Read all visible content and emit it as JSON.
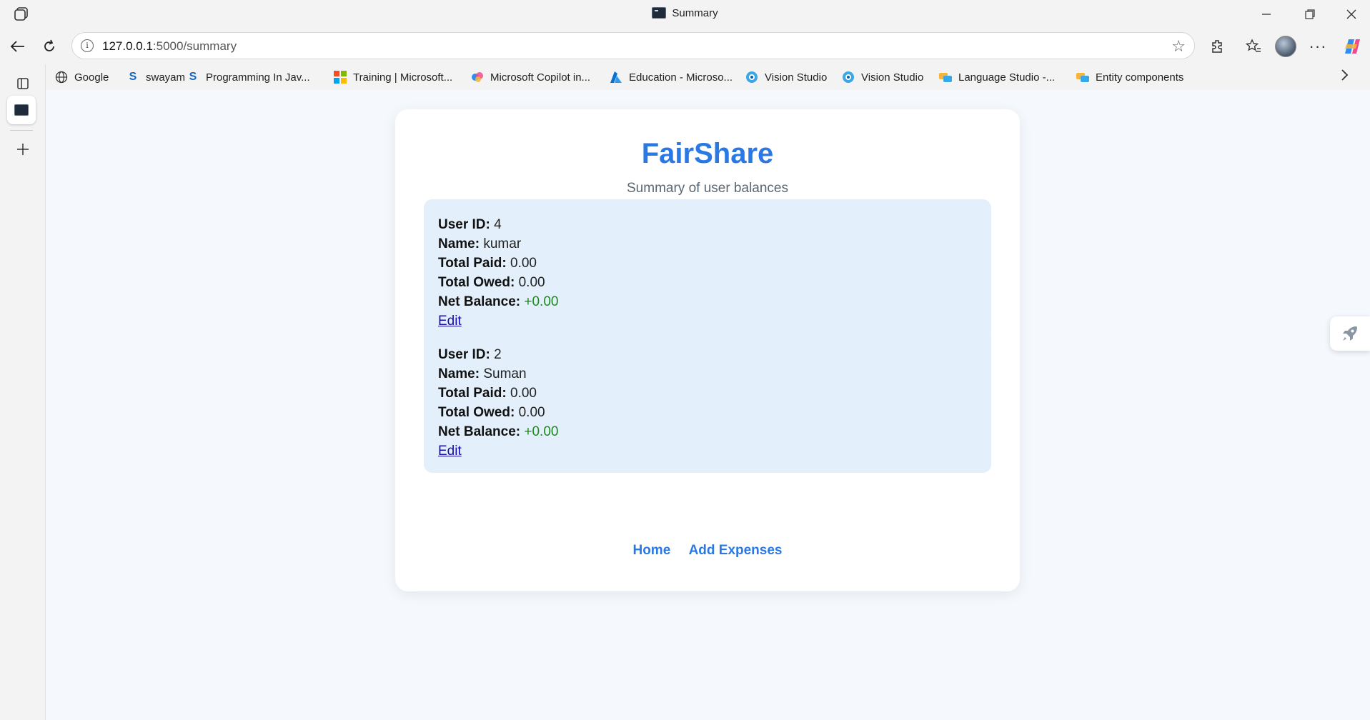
{
  "window": {
    "title": "Summary"
  },
  "address_bar": {
    "host": "127.0.0.1",
    "path": ":5000/summary"
  },
  "bookmarks": [
    {
      "label": "Google",
      "icon": "globe-icon"
    },
    {
      "label": "swayam",
      "icon": "swayam-icon"
    },
    {
      "label": "Programming In Jav...",
      "icon": "swayam-icon"
    },
    {
      "label": "Training | Microsoft...",
      "icon": "microsoft-icon"
    },
    {
      "label": "Microsoft Copilot in...",
      "icon": "copilot-icon"
    },
    {
      "label": "Education - Microso...",
      "icon": "azure-icon"
    },
    {
      "label": "Vision Studio",
      "icon": "vision-icon"
    },
    {
      "label": "Vision Studio",
      "icon": "vision-icon"
    },
    {
      "label": "Language Studio -...",
      "icon": "language-icon"
    },
    {
      "label": "Entity components",
      "icon": "language-icon"
    }
  ],
  "app": {
    "brand": "FairShare",
    "subtitle": "Summary of user balances",
    "labels": {
      "user_id": "User ID:",
      "name": "Name:",
      "total_paid": "Total Paid:",
      "total_owed": "Total Owed:",
      "net_balance": "Net Balance:",
      "edit": "Edit"
    },
    "users": [
      {
        "id": "4",
        "name": "kumar",
        "total_paid": "0.00",
        "total_owed": "0.00",
        "net_balance": "+0.00"
      },
      {
        "id": "2",
        "name": "Suman",
        "total_paid": "0.00",
        "total_owed": "0.00",
        "net_balance": "+0.00"
      }
    ],
    "nav": {
      "home": "Home",
      "add_expenses": "Add Expenses"
    }
  },
  "colors": {
    "brand": "#2a78e4",
    "positive": "#1a8a1a",
    "card_bg": "#e3f0fb",
    "link": "#1a0dab"
  }
}
